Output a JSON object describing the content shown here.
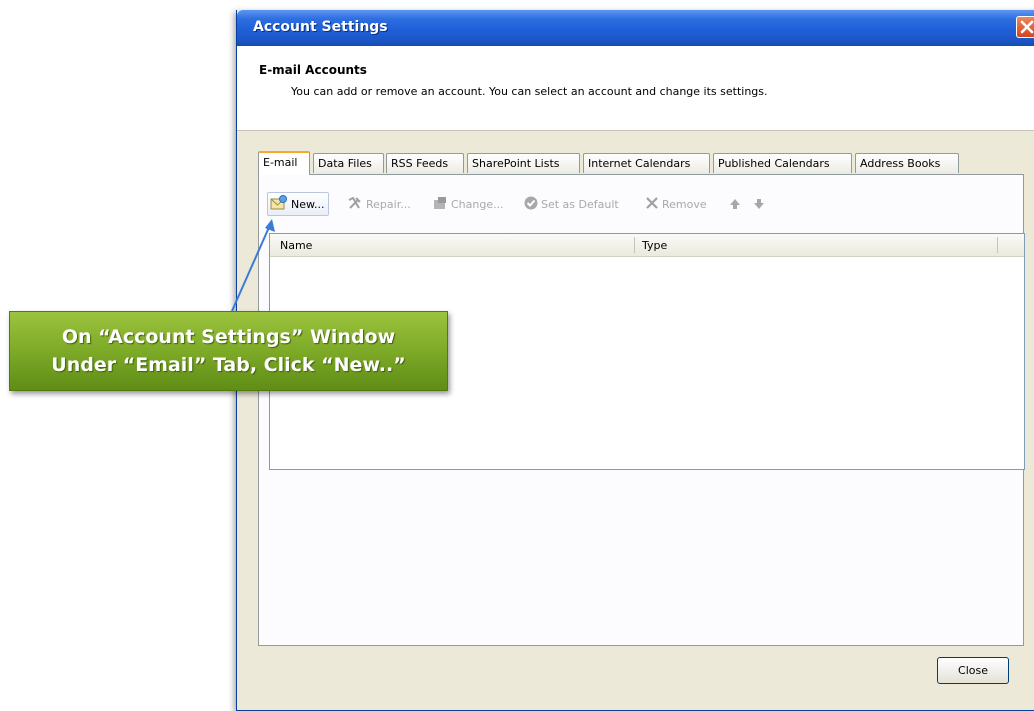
{
  "window": {
    "title": "Account Settings",
    "close_icon": "close-x-icon"
  },
  "header": {
    "title": "E-mail Accounts",
    "description": "You can add or remove an account. You can select an account and change its settings."
  },
  "tabs": [
    {
      "label": "E-mail",
      "active": true
    },
    {
      "label": "Data Files"
    },
    {
      "label": "RSS Feeds"
    },
    {
      "label": "SharePoint Lists"
    },
    {
      "label": "Internet Calendars"
    },
    {
      "label": "Published Calendars"
    },
    {
      "label": "Address Books"
    }
  ],
  "toolbar": {
    "new": "New...",
    "repair": "Repair...",
    "change": "Change...",
    "set_default": "Set as Default",
    "remove": "Remove",
    "up_icon": "move-up-icon",
    "down_icon": "move-down-icon"
  },
  "list": {
    "columns": [
      "Name",
      "Type"
    ],
    "rows": []
  },
  "footer": {
    "close": "Close"
  },
  "callout": {
    "line1": "On “Account Settings” Window",
    "line2": "Under “Email” Tab, Click “New..”"
  },
  "colors": {
    "titlebar": "#1f5fd8",
    "callout_green": "#7daa27",
    "arrow_blue": "#3a7bd5",
    "active_tab_accent": "#f6a830"
  }
}
